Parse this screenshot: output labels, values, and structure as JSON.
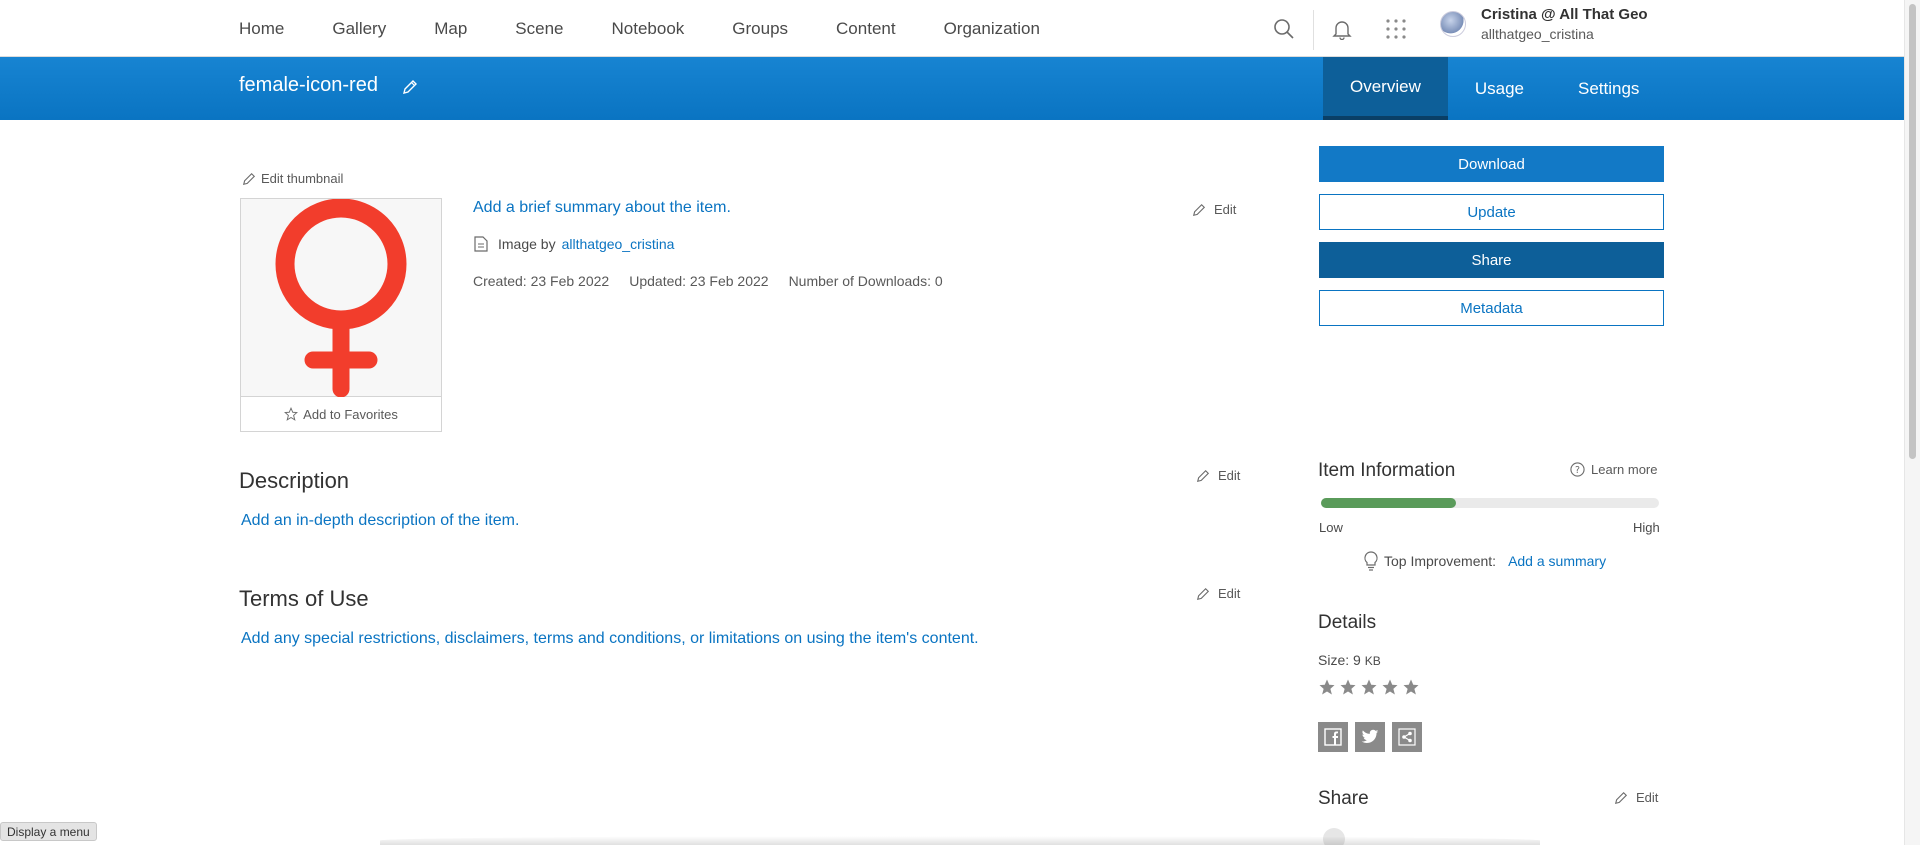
{
  "nav": {
    "items": [
      "Home",
      "Gallery",
      "Map",
      "Scene",
      "Notebook",
      "Groups",
      "Content",
      "Organization"
    ],
    "icons": [
      "search-icon",
      "bell-icon",
      "app-launcher-icon"
    ]
  },
  "user": {
    "name": "Cristina @ All That Geo",
    "username": "allthatgeo_cristina"
  },
  "item": {
    "title": "female-icon-red",
    "tabs": [
      "Overview",
      "Usage",
      "Settings"
    ],
    "active_tab": "Overview"
  },
  "thumbnail": {
    "edit_label": "Edit thumbnail",
    "favorites_label": "Add to Favorites",
    "icon_color": "#f23d2c"
  },
  "summary": {
    "text": "Add a brief summary about the item.",
    "edit": "Edit",
    "type_label": "Image by",
    "owner": "allthatgeo_cristina",
    "created": "Created: 23 Feb 2022",
    "updated": "Updated: 23 Feb 2022",
    "downloads": "Number of Downloads: 0"
  },
  "description": {
    "title": "Description",
    "placeholder": "Add an in-depth description of the item.",
    "edit": "Edit"
  },
  "terms": {
    "title": "Terms of Use",
    "placeholder": "Add any special restrictions, disclaimers, terms and conditions, or limitations on using the item's content.",
    "edit": "Edit"
  },
  "actions": {
    "download": "Download",
    "update": "Update",
    "share": "Share",
    "metadata": "Metadata"
  },
  "item_information": {
    "title": "Item Information",
    "learn_more": "Learn more",
    "score_fraction": 0.4,
    "low": "Low",
    "high": "High",
    "top_improvement_label": "Top Improvement:",
    "top_improvement_link": "Add a summary",
    "meter_color": "#5a9b5a"
  },
  "details": {
    "title": "Details",
    "size_label": "Size: 9",
    "size_unit": "KB",
    "rating_stars": 5,
    "social": [
      "facebook-icon",
      "twitter-icon",
      "share-link-icon"
    ]
  },
  "share": {
    "title": "Share",
    "edit": "Edit"
  },
  "tooltip": "Display a menu",
  "colors": {
    "brand_blue": "#0a74c2",
    "header_blue": "#1784d2",
    "active_tab": "#0d5f99"
  }
}
